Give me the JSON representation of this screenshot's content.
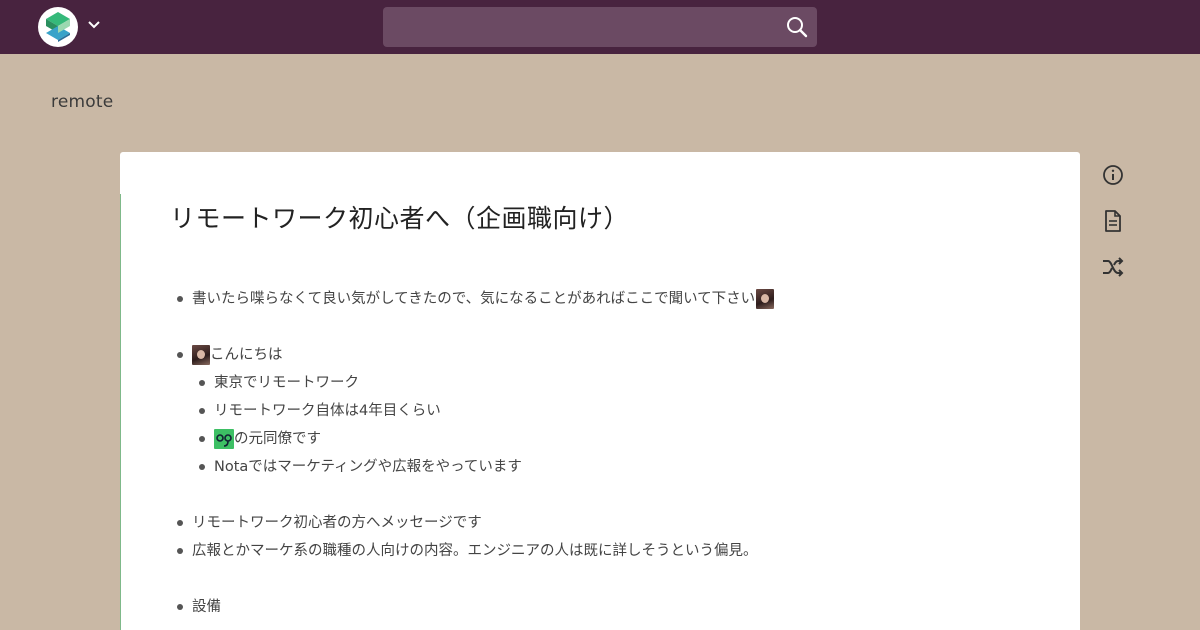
{
  "header": {
    "search": {
      "value": "",
      "placeholder": ""
    }
  },
  "project": {
    "name": "remote"
  },
  "page": {
    "title": "リモートワーク初心者へ（企画職向け）",
    "lines": [
      {
        "indent": 0,
        "text": "書いたら喋らなくて良い気がしてきたので、気になることがあればここで聞いて下さい",
        "prefix": "",
        "suffix": "avatar"
      },
      {
        "indent": 0,
        "text": "こんにちは",
        "prefix": "avatar",
        "suffix": ""
      },
      {
        "indent": 1,
        "text": "東京でリモートワーク",
        "prefix": "",
        "suffix": ""
      },
      {
        "indent": 1,
        "text": "リモートワーク自体は4年目くらい",
        "prefix": "",
        "suffix": ""
      },
      {
        "indent": 1,
        "text": "の元同僚です",
        "prefix": "nota-icon",
        "suffix": ""
      },
      {
        "indent": 1,
        "text": "Notaではマーケティングや広報をやっています",
        "prefix": "",
        "suffix": ""
      },
      {
        "indent": 0,
        "text": "リモートワーク初心者の方へメッセージです",
        "prefix": "",
        "suffix": ""
      },
      {
        "indent": 0,
        "text": "広報とかマーケ系の職種の人向けの内容。エンジニアの人は既に詳しそうという偏見。",
        "prefix": "",
        "suffix": ""
      },
      {
        "indent": 0,
        "text": "設備",
        "prefix": "",
        "suffix": ""
      }
    ]
  },
  "sidebar_icons": [
    "info-icon",
    "page-icon",
    "shuffle-icon"
  ],
  "colors": {
    "header_bg": "#48233f",
    "page_bg": "#c9b8a5",
    "search_bg": "#6b4a63",
    "card_bg": "#ffffff",
    "accent_green": "#7fb98a"
  }
}
